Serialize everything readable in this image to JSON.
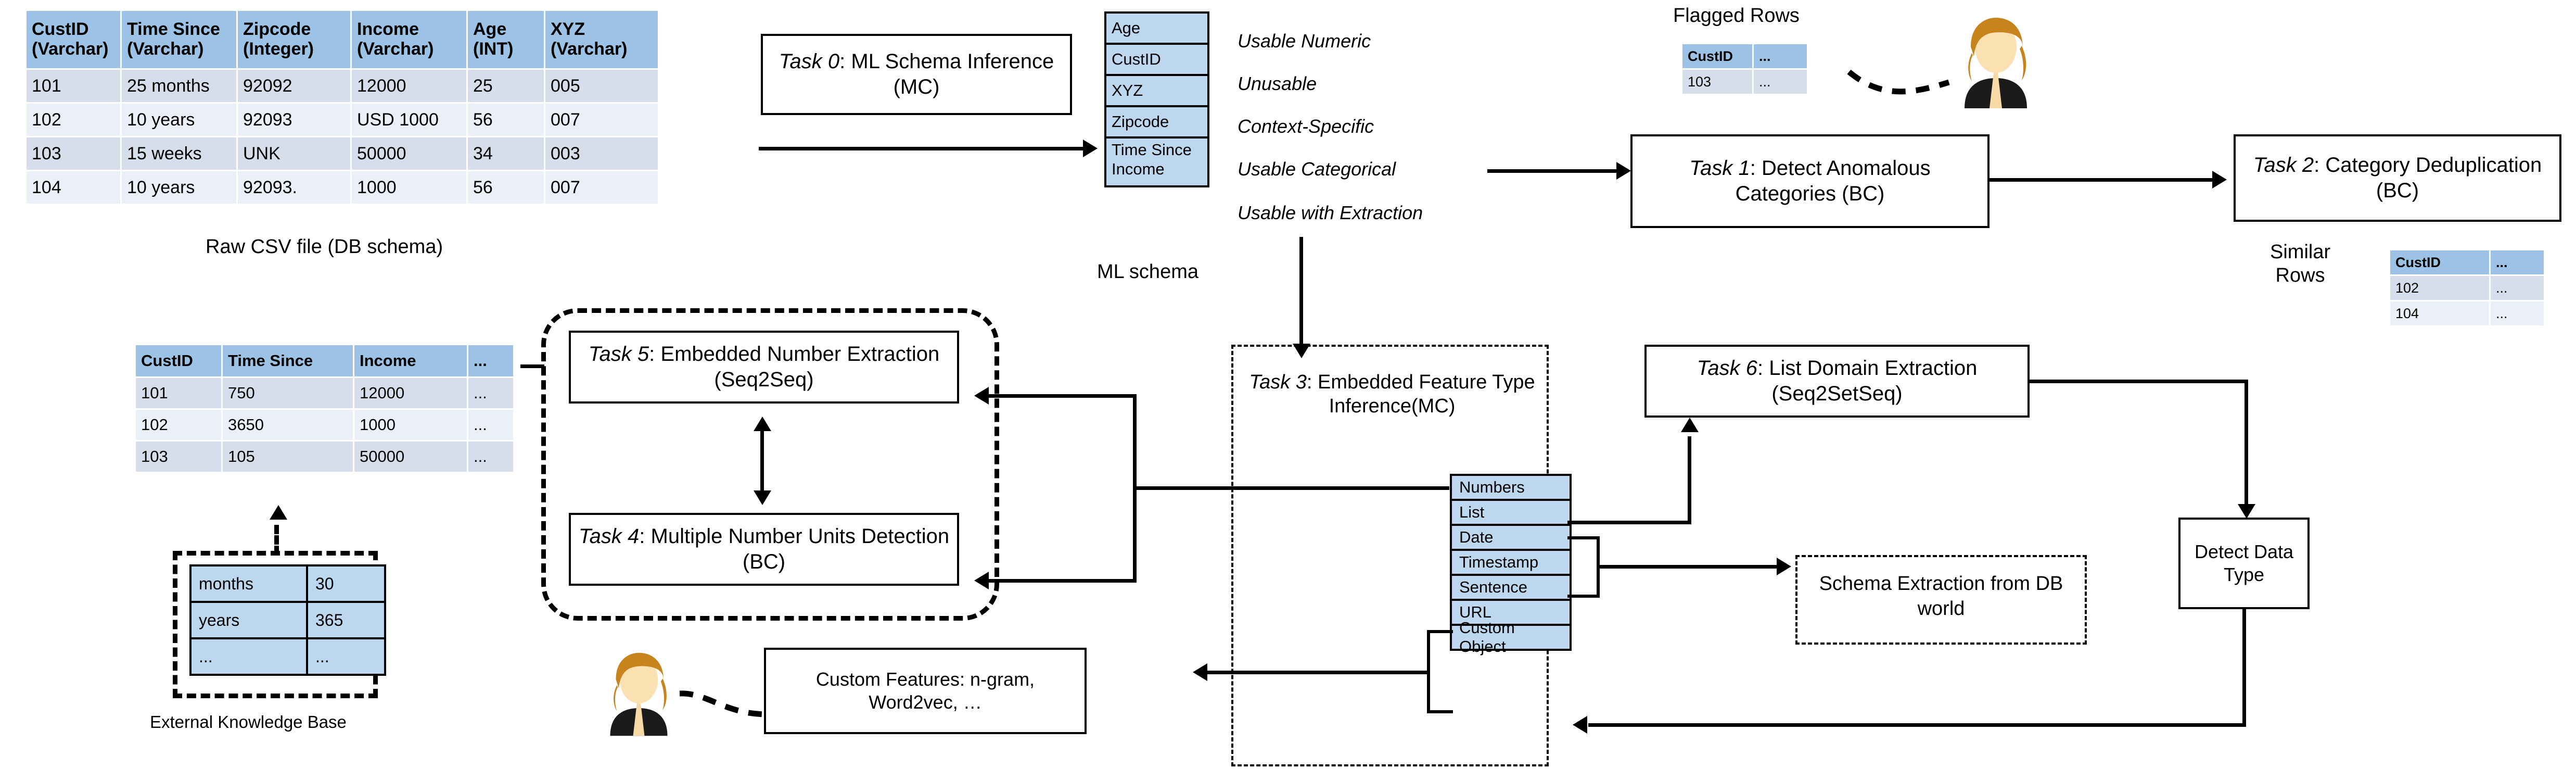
{
  "raw_table": {
    "caption": "Raw CSV file (DB schema)",
    "headers": [
      "CustID\n(Varchar)",
      "Time Since\n(Varchar)",
      "Zipcode\n(Integer)",
      "Income\n(Varchar)",
      "Age\n(INT)",
      "XYZ\n(Varchar)"
    ],
    "rows": [
      [
        "101",
        "25 months",
        "92092",
        "12000",
        "25",
        "005"
      ],
      [
        "102",
        "10 years",
        "92093",
        "USD 1000",
        "56",
        "007"
      ],
      [
        "103",
        "15 weeks",
        "UNK",
        "50000",
        "34",
        "003"
      ],
      [
        "104",
        "10 years",
        "92093.",
        "1000",
        "56",
        "007"
      ]
    ]
  },
  "task0": {
    "prefix": "Task 0",
    "text": ": ML Schema Inference (MC)"
  },
  "ml_schema": {
    "caption": "ML schema",
    "items": [
      "Age",
      "CustID",
      "XYZ",
      "Zipcode",
      "Time Since\nIncome"
    ],
    "annotations": [
      "Usable Numeric",
      "Unusable",
      "Context-Specific",
      "Usable Categorical",
      "Usable with Extraction"
    ]
  },
  "flagged": {
    "caption": "Flagged Rows",
    "headers": [
      "CustID",
      "..."
    ],
    "rows": [
      [
        "103",
        "..."
      ]
    ]
  },
  "similar": {
    "caption": "Similar\nRows",
    "headers": [
      "CustID",
      "..."
    ],
    "rows": [
      [
        "102",
        "..."
      ],
      [
        "104",
        "..."
      ]
    ]
  },
  "task1": {
    "prefix": "Task 1",
    "text": ": Detect Anomalous Categories (BC)"
  },
  "task2": {
    "prefix": "Task 2",
    "text": ": Category Deduplication (BC)"
  },
  "extracted_table": {
    "headers": [
      "CustID",
      "Time Since",
      "Income",
      "..."
    ],
    "rows": [
      [
        "101",
        "750",
        "12000",
        "..."
      ],
      [
        "102",
        "3650",
        "1000",
        "..."
      ],
      [
        "103",
        "105",
        "50000",
        "..."
      ]
    ]
  },
  "kb": {
    "caption": "External  Knowledge  Base",
    "rows": [
      [
        "months",
        "30"
      ],
      [
        "years",
        "365"
      ],
      [
        "...",
        "..."
      ]
    ]
  },
  "task5": {
    "prefix": "Task 5",
    "text": ": Embedded Number Extraction (Seq2Seq)"
  },
  "task4": {
    "prefix": "Task 4",
    "text": ": Multiple Number Units Detection (BC)"
  },
  "task3": {
    "prefix": "Task 3",
    "text": ": Embedded Feature Type Inference(MC)",
    "feature_types": [
      "Numbers",
      "List",
      "Date",
      "Timestamp",
      "Sentence",
      "URL",
      "Custom Object"
    ]
  },
  "task6": {
    "prefix": "Task 6",
    "text": ": List Domain Extraction (Seq2SetSeq)"
  },
  "schema_extraction": {
    "text": "Schema Extraction from DB world"
  },
  "detect_data_type": {
    "text": "Detect Data Type"
  },
  "custom_features": {
    "text": "Custom Features: n-gram, Word2vec, …"
  },
  "colors": {
    "header_blue": "#9CC3E5",
    "row_dark": "#D6DEEB",
    "row_light": "#EBEFF8",
    "schema_blue": "#BDD7EE",
    "line": "#000000",
    "background": "#FFFFFF"
  }
}
